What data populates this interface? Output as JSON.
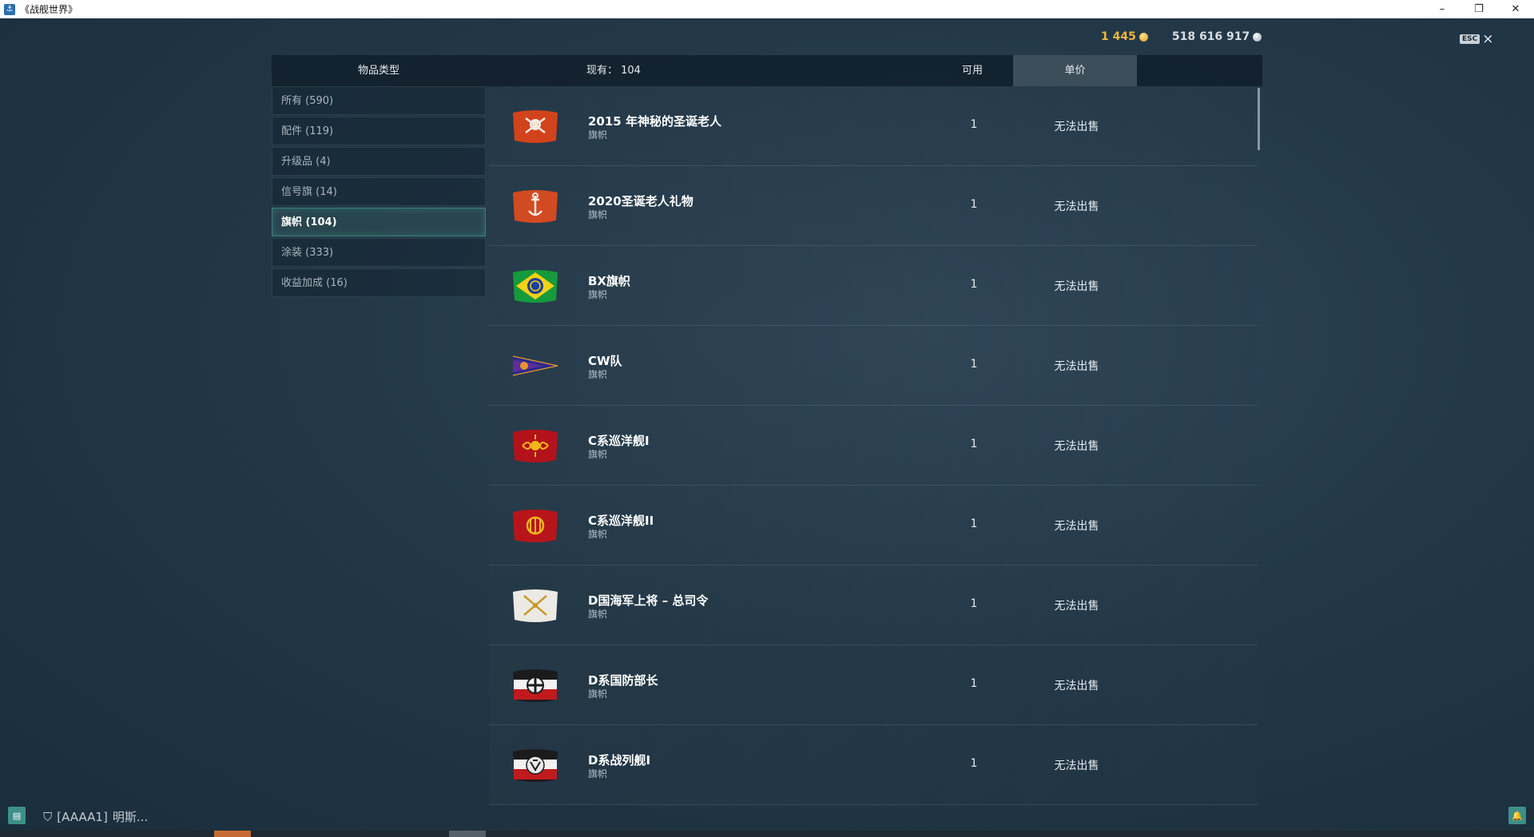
{
  "window": {
    "title": "《战舰世界》",
    "controls": [
      "–",
      "❐",
      "✕"
    ]
  },
  "currency": {
    "gold": "1 445",
    "silver": "518 616 917"
  },
  "esc": {
    "label": "ESC",
    "close": "×"
  },
  "header": {
    "item_type": "物品类型",
    "owned": "现有：  104",
    "available": "可用",
    "unit_price": "单价"
  },
  "categories": [
    {
      "label": "所有 (590)",
      "active": false
    },
    {
      "label": "配件 (119)",
      "active": false
    },
    {
      "label": "升级品 (4)",
      "active": false
    },
    {
      "label": "信号旗 (14)",
      "active": false
    },
    {
      "label": "旗帜 (104)",
      "active": true
    },
    {
      "label": "涂装 (333)",
      "active": false
    },
    {
      "label": "收益加成 (16)",
      "active": false
    }
  ],
  "items": [
    {
      "name": "2015 年神秘的圣诞老人",
      "type": "旗帜",
      "qty": "1",
      "price": "无法出售",
      "icon": "santa-skull-flag-icon"
    },
    {
      "name": "2020圣诞老人礼物",
      "type": "旗帜",
      "qty": "1",
      "price": "无法出售",
      "icon": "anchor-2020-flag-icon"
    },
    {
      "name": "BX旗帜",
      "type": "旗帜",
      "qty": "1",
      "price": "无法出售",
      "icon": "brazil-flag-icon"
    },
    {
      "name": "CW队",
      "type": "旗帜",
      "qty": "1",
      "price": "无法出售",
      "icon": "pennant-flag-icon"
    },
    {
      "name": "C系巡洋舰I",
      "type": "旗帜",
      "qty": "1",
      "price": "无法出售",
      "icon": "ornament-red-flag-icon"
    },
    {
      "name": "C系巡洋舰II",
      "type": "旗帜",
      "qty": "1",
      "price": "无法出售",
      "icon": "emblem-red-flag-icon"
    },
    {
      "name": "D国海军上将 – 总司令",
      "type": "旗帜",
      "qty": "1",
      "price": "无法出售",
      "icon": "crossed-swords-flag-icon"
    },
    {
      "name": "D系国防部长",
      "type": "旗帜",
      "qty": "1",
      "price": "无法出售",
      "icon": "iron-cross-flag-icon"
    },
    {
      "name": "D系战列舰I",
      "type": "旗帜",
      "qty": "1",
      "price": "无法出售",
      "icon": "eagle-flag-icon"
    }
  ],
  "footer": {
    "clan": "[AAAA1]",
    "player": "明斯..."
  },
  "colors": {
    "gold": "#f2b53a",
    "active_border": "#3d7f7a",
    "background": "#223848"
  }
}
